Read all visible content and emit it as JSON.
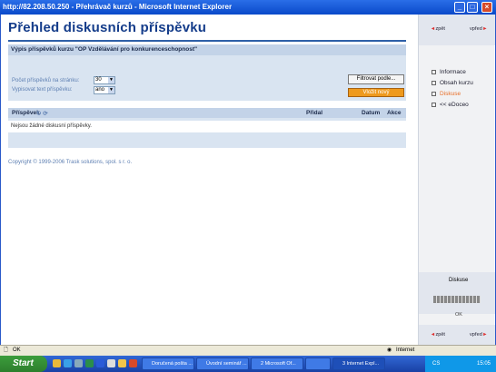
{
  "window": {
    "title": "http://82.208.50.250 - Přehrávač kurzů - Microsoft Internet Explorer",
    "controls": [
      "_",
      "□",
      "×"
    ]
  },
  "page": {
    "title": "Přehled diskusních příspěvku",
    "listing_header": "Výpis příspěvků kurzu \"OP Vzdělávání pro konkurenceschopnost\"",
    "per_page_label": "Počet příspěvků na stránku:",
    "per_page_value": "30",
    "show_text_label": "Vypisovat text příspěvku:",
    "show_text_value": "ano",
    "filter_button": "Filtrovat podle...",
    "new_button": "Vložit nový",
    "table": {
      "columns": [
        "Příspěvek",
        "Přidal",
        "Datum",
        "Akce"
      ],
      "empty": "Nejsou žádné diskusní příspěvky."
    },
    "copyright": "Copyright © 1999-2006 Trask solutions, spol. s r. o."
  },
  "sidebar": {
    "back": "zpět",
    "forward": "vpřed",
    "menu": [
      "Informace",
      "Obsah kurzu",
      "Diskuse",
      "<< eDoceo"
    ],
    "active_index": 2,
    "section_label": "Diskuse",
    "status_label": "OK",
    "progress": 1.0
  },
  "statusbar": {
    "left": "OK",
    "zone": "Internet"
  },
  "taskbar": {
    "start": "Start",
    "tasks": [
      "Doručená pošta ...",
      "Úvodní seminář ...",
      "2 Microsoft Of...",
      "",
      "3 Internet Expl..."
    ],
    "tray_label": "CS",
    "clock": "15:05"
  },
  "colors": {
    "accent": "#143c8a",
    "panel": "#d9e4f1",
    "orange": "#f09a19",
    "active_menu": "#e8702a"
  }
}
